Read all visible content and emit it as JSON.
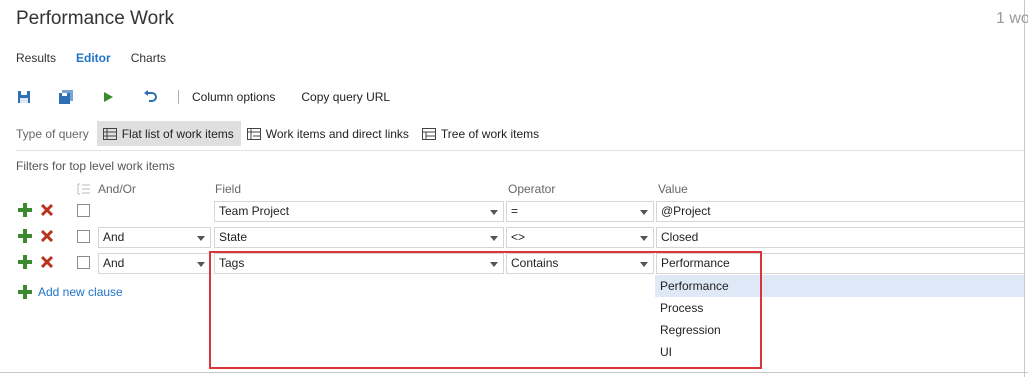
{
  "header": {
    "title": "Performance Work",
    "count": "1 wo"
  },
  "tabs": [
    {
      "label": "Results"
    },
    {
      "label": "Editor"
    },
    {
      "label": "Charts"
    }
  ],
  "toolbar": {
    "icons": [
      "save-icon",
      "save-as-icon",
      "run-icon",
      "undo-icon"
    ],
    "column_options": "Column options",
    "copy_query_url": "Copy query URL"
  },
  "query_type": {
    "label": "Type of query",
    "options": [
      {
        "label": "Flat list of work items",
        "selected": true
      },
      {
        "label": "Work items and direct links",
        "selected": false
      },
      {
        "label": "Tree of work items",
        "selected": false
      }
    ]
  },
  "filters": {
    "title": "Filters for top level work items",
    "headers": {
      "andor": "And/Or",
      "field": "Field",
      "operator": "Operator",
      "value": "Value"
    },
    "rows": [
      {
        "andor": "",
        "field": "Team Project",
        "operator": "=",
        "value": "@Project"
      },
      {
        "andor": "And",
        "field": "State",
        "operator": "<>",
        "value": "Closed"
      },
      {
        "andor": "And",
        "field": "Tags",
        "operator": "Contains",
        "value": "Performance"
      }
    ],
    "add_clause": "Add new clause"
  },
  "value_dropdown": {
    "options": [
      "Performance",
      "Process",
      "Regression",
      "UI"
    ],
    "highlighted": "Performance"
  },
  "colors": {
    "accent": "#1e73c8",
    "add_green": "#3c8a2e",
    "remove_red": "#b8331f",
    "callout_red": "#d9353a",
    "dropdown_highlight": "#dfe8f6"
  }
}
